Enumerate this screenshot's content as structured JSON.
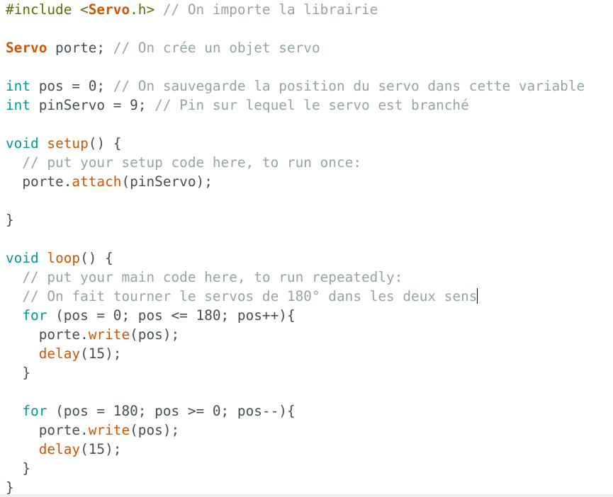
{
  "colors": {
    "background": "#ffffff",
    "plain": "#434f54",
    "comment": "#95a5a6",
    "keyword": "#00979c",
    "function": "#d35400",
    "preprocessor": "#5e6d03"
  },
  "code": {
    "lines": [
      [
        {
          "t": "#include <",
          "c": "pp"
        },
        {
          "t": "Servo",
          "c": "cls"
        },
        {
          "t": ".h> ",
          "c": "pp"
        },
        {
          "t": "// On importe la librairie",
          "c": "cmt"
        }
      ],
      [],
      [
        {
          "t": "Servo",
          "c": "cls"
        },
        {
          "t": " porte; ",
          "c": "plain"
        },
        {
          "t": "// On crée un objet servo",
          "c": "cmt"
        }
      ],
      [],
      [
        {
          "t": "int",
          "c": "kw"
        },
        {
          "t": " pos = 0; ",
          "c": "plain"
        },
        {
          "t": "// On sauvegarde la position du servo dans cette variable",
          "c": "cmt"
        }
      ],
      [
        {
          "t": "int",
          "c": "kw"
        },
        {
          "t": " pinServo = 9; ",
          "c": "plain"
        },
        {
          "t": "// Pin sur lequel le servo est branché",
          "c": "cmt"
        }
      ],
      [],
      [
        {
          "t": "void",
          "c": "kw"
        },
        {
          "t": " ",
          "c": "plain"
        },
        {
          "t": "setup",
          "c": "fn"
        },
        {
          "t": "() {",
          "c": "plain"
        }
      ],
      [
        {
          "t": "  // put your setup code here, to run once:",
          "c": "cmt"
        }
      ],
      [
        {
          "t": "  porte.",
          "c": "plain"
        },
        {
          "t": "attach",
          "c": "fn"
        },
        {
          "t": "(pinServo);",
          "c": "plain"
        }
      ],
      [],
      [
        {
          "t": "}",
          "c": "plain"
        }
      ],
      [],
      [
        {
          "t": "void",
          "c": "kw"
        },
        {
          "t": " ",
          "c": "plain"
        },
        {
          "t": "loop",
          "c": "fn"
        },
        {
          "t": "() {",
          "c": "plain"
        }
      ],
      [
        {
          "t": "  // put your main code here, to run repeatedly:",
          "c": "cmt"
        }
      ],
      [
        {
          "t": "  // On fait tourner le servos de 180° dans les deux sens",
          "c": "cmt"
        },
        {
          "t": "",
          "c": "caret"
        }
      ],
      [
        {
          "t": "  ",
          "c": "plain"
        },
        {
          "t": "for",
          "c": "kw"
        },
        {
          "t": " (pos = 0; pos <= 180; pos++){",
          "c": "plain"
        }
      ],
      [
        {
          "t": "    porte.",
          "c": "plain"
        },
        {
          "t": "write",
          "c": "fn"
        },
        {
          "t": "(pos);",
          "c": "plain"
        }
      ],
      [
        {
          "t": "    ",
          "c": "plain"
        },
        {
          "t": "delay",
          "c": "fn"
        },
        {
          "t": "(15);",
          "c": "plain"
        }
      ],
      [
        {
          "t": "  }",
          "c": "plain"
        }
      ],
      [],
      [
        {
          "t": "  ",
          "c": "plain"
        },
        {
          "t": "for",
          "c": "kw"
        },
        {
          "t": " (pos = 180; pos >= 0; pos--){",
          "c": "plain"
        }
      ],
      [
        {
          "t": "    porte.",
          "c": "plain"
        },
        {
          "t": "write",
          "c": "fn"
        },
        {
          "t": "(pos);",
          "c": "plain"
        }
      ],
      [
        {
          "t": "    ",
          "c": "plain"
        },
        {
          "t": "delay",
          "c": "fn"
        },
        {
          "t": "(15);",
          "c": "plain"
        }
      ],
      [
        {
          "t": "  }",
          "c": "plain"
        }
      ],
      [
        {
          "t": "}",
          "c": "plain"
        }
      ]
    ]
  }
}
